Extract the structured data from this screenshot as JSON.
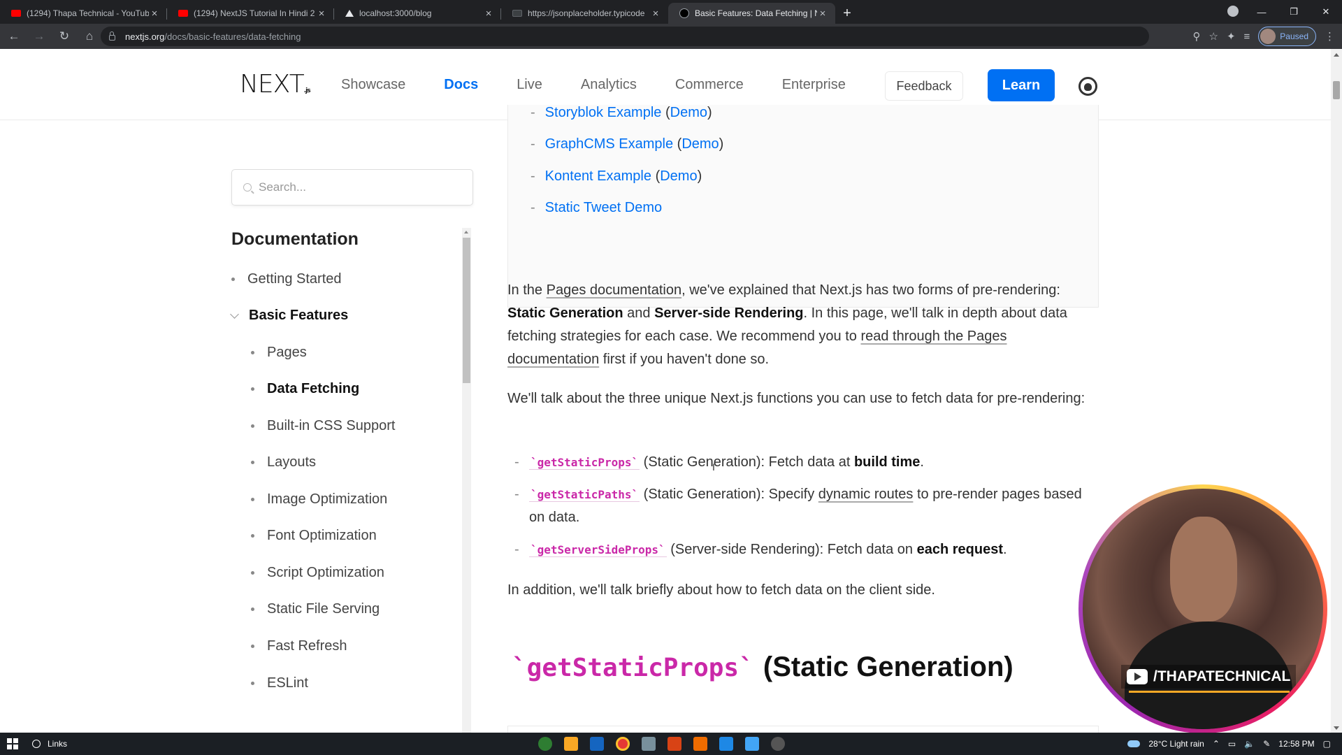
{
  "browser": {
    "tabs": [
      {
        "title": "(1294) Thapa Technical - YouTube",
        "favicon": "youtube-icon"
      },
      {
        "title": "(1294) NextJS Tutorial In Hindi 2",
        "favicon": "youtube-icon"
      },
      {
        "title": "localhost:3000/blog",
        "favicon": "triangle-icon"
      },
      {
        "title": "https://jsonplaceholder.typicode",
        "favicon": "page-icon"
      },
      {
        "title": "Basic Features: Data Fetching | N",
        "favicon": "nextjs-icon",
        "active": true
      }
    ],
    "url_host": "nextjs.org",
    "url_path": "/docs/basic-features/data-fetching",
    "profile_status": "Paused"
  },
  "header": {
    "logo": "NEXT",
    "logo_suffix": ".js",
    "nav": [
      "Showcase",
      "Docs",
      "Live",
      "Analytics",
      "Commerce",
      "Enterprise"
    ],
    "active_nav": "Docs",
    "feedback_label": "Feedback",
    "learn_label": "Learn"
  },
  "sidebar": {
    "search_placeholder": "Search...",
    "title": "Documentation",
    "items": [
      {
        "label": "Getting Started",
        "level": 0
      },
      {
        "label": "Basic Features",
        "level": 0,
        "expanded": true
      },
      {
        "label": "Pages",
        "level": 1
      },
      {
        "label": "Data Fetching",
        "level": 1,
        "active": true
      },
      {
        "label": "Built-in CSS Support",
        "level": 1
      },
      {
        "label": "Layouts",
        "level": 1
      },
      {
        "label": "Image Optimization",
        "level": 1
      },
      {
        "label": "Font Optimization",
        "level": 1
      },
      {
        "label": "Script Optimization",
        "level": 1
      },
      {
        "label": "Static File Serving",
        "level": 1
      },
      {
        "label": "Fast Refresh",
        "level": 1
      },
      {
        "label": "ESLint",
        "level": 1
      }
    ]
  },
  "main": {
    "examples": [
      {
        "label": "Storyblok Example",
        "demo": "Demo"
      },
      {
        "label": "GraphCMS Example",
        "demo": "Demo"
      },
      {
        "label": "Kontent Example",
        "demo": "Demo"
      },
      {
        "label": "Static Tweet Demo",
        "demo": ""
      }
    ],
    "intro": {
      "t1": "In the ",
      "link1": "Pages documentation",
      "t2": ", we've explained that Next.js has two forms of pre-rendering: ",
      "b1": "Static Generation",
      "t3": " and ",
      "b2": "Server-side Rendering",
      "t4": ". In this page, we'll talk in depth about data fetching strategies for each case. We recommend you to ",
      "link2": "read through the Pages documentation",
      "t5": " first if you haven't done so."
    },
    "functions_intro": "We'll talk about the three unique Next.js functions you can use to fetch data for pre-rendering:",
    "functions": [
      {
        "code": "`getStaticProps`",
        "t1": " (Static Generation): Fetch data at ",
        "bold": "build time",
        "link": "",
        "t2": "."
      },
      {
        "code": "`getStaticPaths`",
        "t1": " (Static Generation): Specify ",
        "bold": "",
        "link": "dynamic routes",
        "t2": " to pre-render pages based on data."
      },
      {
        "code": "`getServerSideProps`",
        "t1": " (Server-side Rendering): Fetch data on ",
        "bold": "each request",
        "link": "",
        "t2": "."
      }
    ],
    "closing": "In addition, we'll talk briefly about how to fetch data on the client side.",
    "heading_code": "`getStaticProps`",
    "heading_text": " (Static Generation)"
  },
  "overlay": {
    "handle": "/THAPATECHNICAL"
  },
  "taskbar": {
    "search_label": "Links",
    "weather": "28°C  Light rain",
    "time": "12:58 PM"
  },
  "colors": {
    "link": "#0070f3",
    "code": "#ca28a8",
    "learn_button": "#0070f3"
  }
}
